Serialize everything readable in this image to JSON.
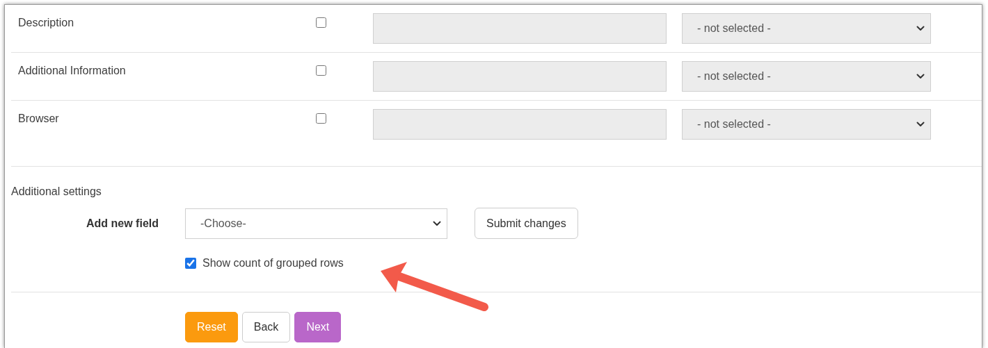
{
  "field_rows": [
    {
      "label": "Description",
      "checked": false,
      "select": {
        "value": "- not selected -"
      }
    },
    {
      "label": "Additional Information",
      "checked": false,
      "select": {
        "value": "- not selected -"
      }
    },
    {
      "label": "Browser",
      "checked": false,
      "select": {
        "value": "- not selected -"
      }
    }
  ],
  "additional_settings": {
    "heading": "Additional settings",
    "add_field_label": "Add new field",
    "add_field_select": "-Choose-",
    "submit_button": "Submit changes",
    "show_count": {
      "label": "Show count of grouped rows",
      "checked": true
    }
  },
  "buttons": [
    {
      "label": "Reset",
      "kind": "reset"
    },
    {
      "label": "Back",
      "kind": "back"
    },
    {
      "label": "Next",
      "kind": "next"
    }
  ]
}
